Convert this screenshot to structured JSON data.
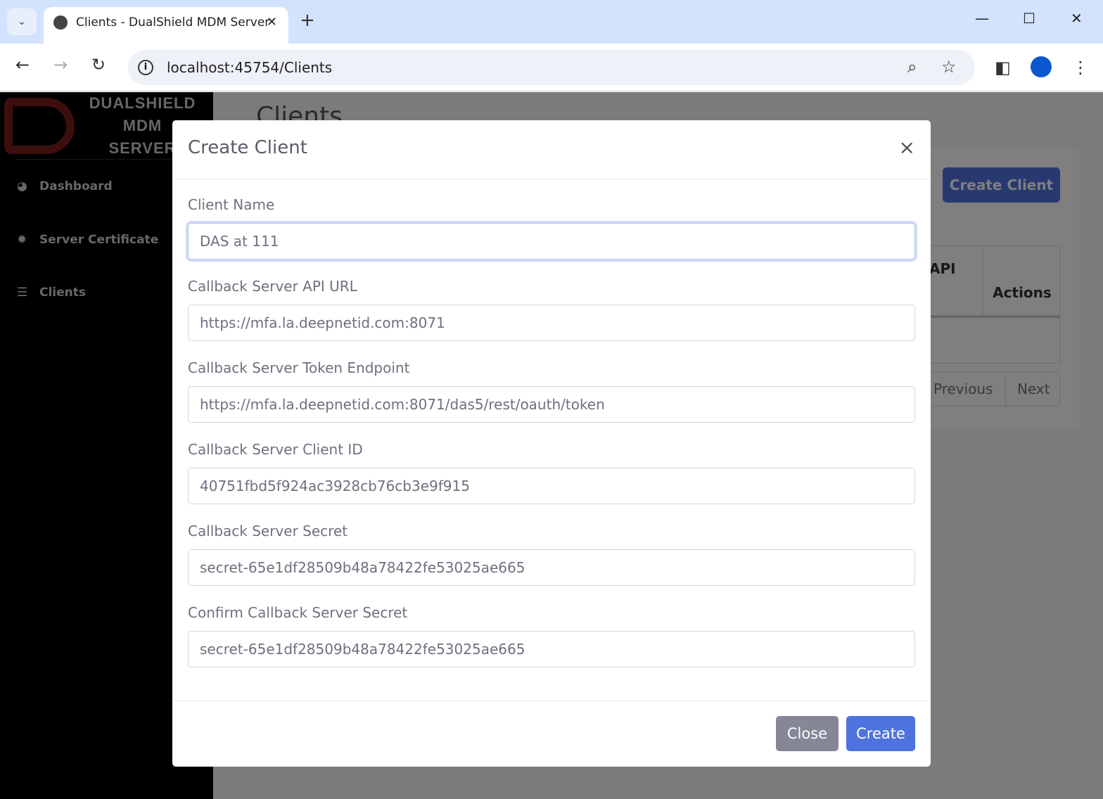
{
  "browser": {
    "tab_title": "Clients - DualShield MDM Server",
    "url": "localhost:45754/Clients"
  },
  "sidebar": {
    "brand": [
      "DUALSHIELD",
      "MDM",
      "SERVER"
    ],
    "items": [
      {
        "label": "Dashboard"
      },
      {
        "label": "Server Certificate"
      },
      {
        "label": "Clients"
      }
    ]
  },
  "main": {
    "title": "Clients",
    "create_button": "Create Client",
    "table_headers": [
      "API",
      "Actions"
    ],
    "pager": {
      "previous": "Previous",
      "next": "Next"
    }
  },
  "modal": {
    "title": "Create Client",
    "close_icon": "×",
    "fields": [
      {
        "label": "Client Name",
        "value": "DAS at 111"
      },
      {
        "label": "Callback Server API URL",
        "value": "https://mfa.la.deepnetid.com:8071"
      },
      {
        "label": "Callback Server Token Endpoint",
        "value": "https://mfa.la.deepnetid.com:8071/das5/rest/oauth/token"
      },
      {
        "label": "Callback Server Client ID",
        "value": "40751fbd5f924ac3928cb76cb3e9f915"
      },
      {
        "label": "Callback Server Secret",
        "value": "secret-65e1df28509b48a78422fe53025ae665"
      },
      {
        "label": "Confirm Callback Server Secret",
        "value": "secret-65e1df28509b48a78422fe53025ae665"
      }
    ],
    "close_button": "Close",
    "create_button": "Create"
  },
  "colors": {
    "primary": "#4e73df",
    "secondary": "#858796",
    "logo": "#7a1c1c"
  }
}
